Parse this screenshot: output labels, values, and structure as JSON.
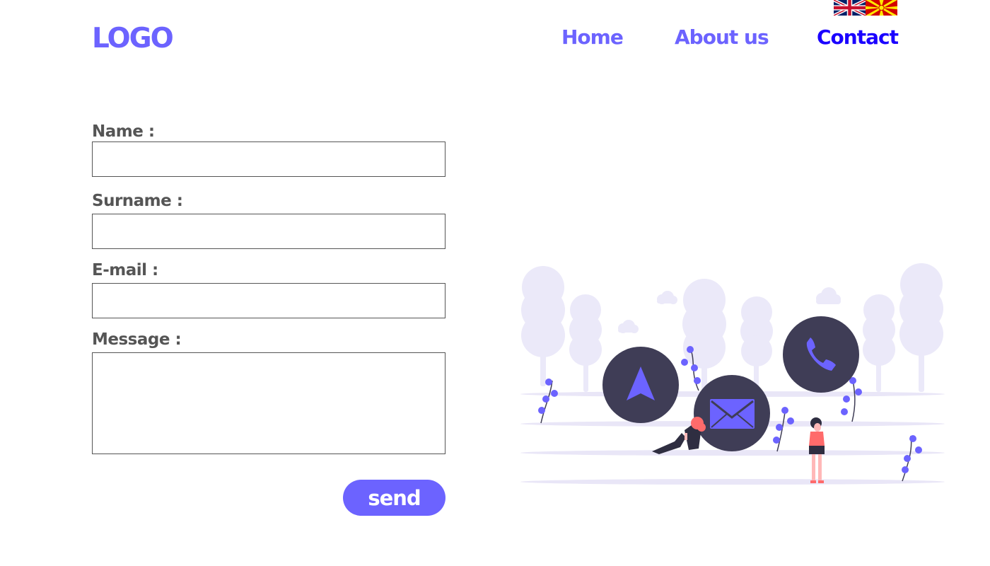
{
  "header": {
    "logo": "LOGO",
    "nav": {
      "home": "Home",
      "about": "About us",
      "contact": "Contact"
    },
    "languages": [
      "en-flag",
      "mk-flag"
    ]
  },
  "form": {
    "name_label": "Name :",
    "surname_label": "Surname :",
    "email_label": "E-mail :",
    "message_label": "Message :",
    "name_value": "",
    "surname_value": "",
    "email_value": "",
    "message_value": "",
    "send_label": "send"
  },
  "colors": {
    "accent": "#6c63ff",
    "active_nav": "#1a00ff",
    "label": "#555555",
    "icon_circle": "#3f3d56"
  },
  "illustration": {
    "icons": [
      "navigation-icon",
      "mail-icon",
      "phone-icon"
    ]
  }
}
